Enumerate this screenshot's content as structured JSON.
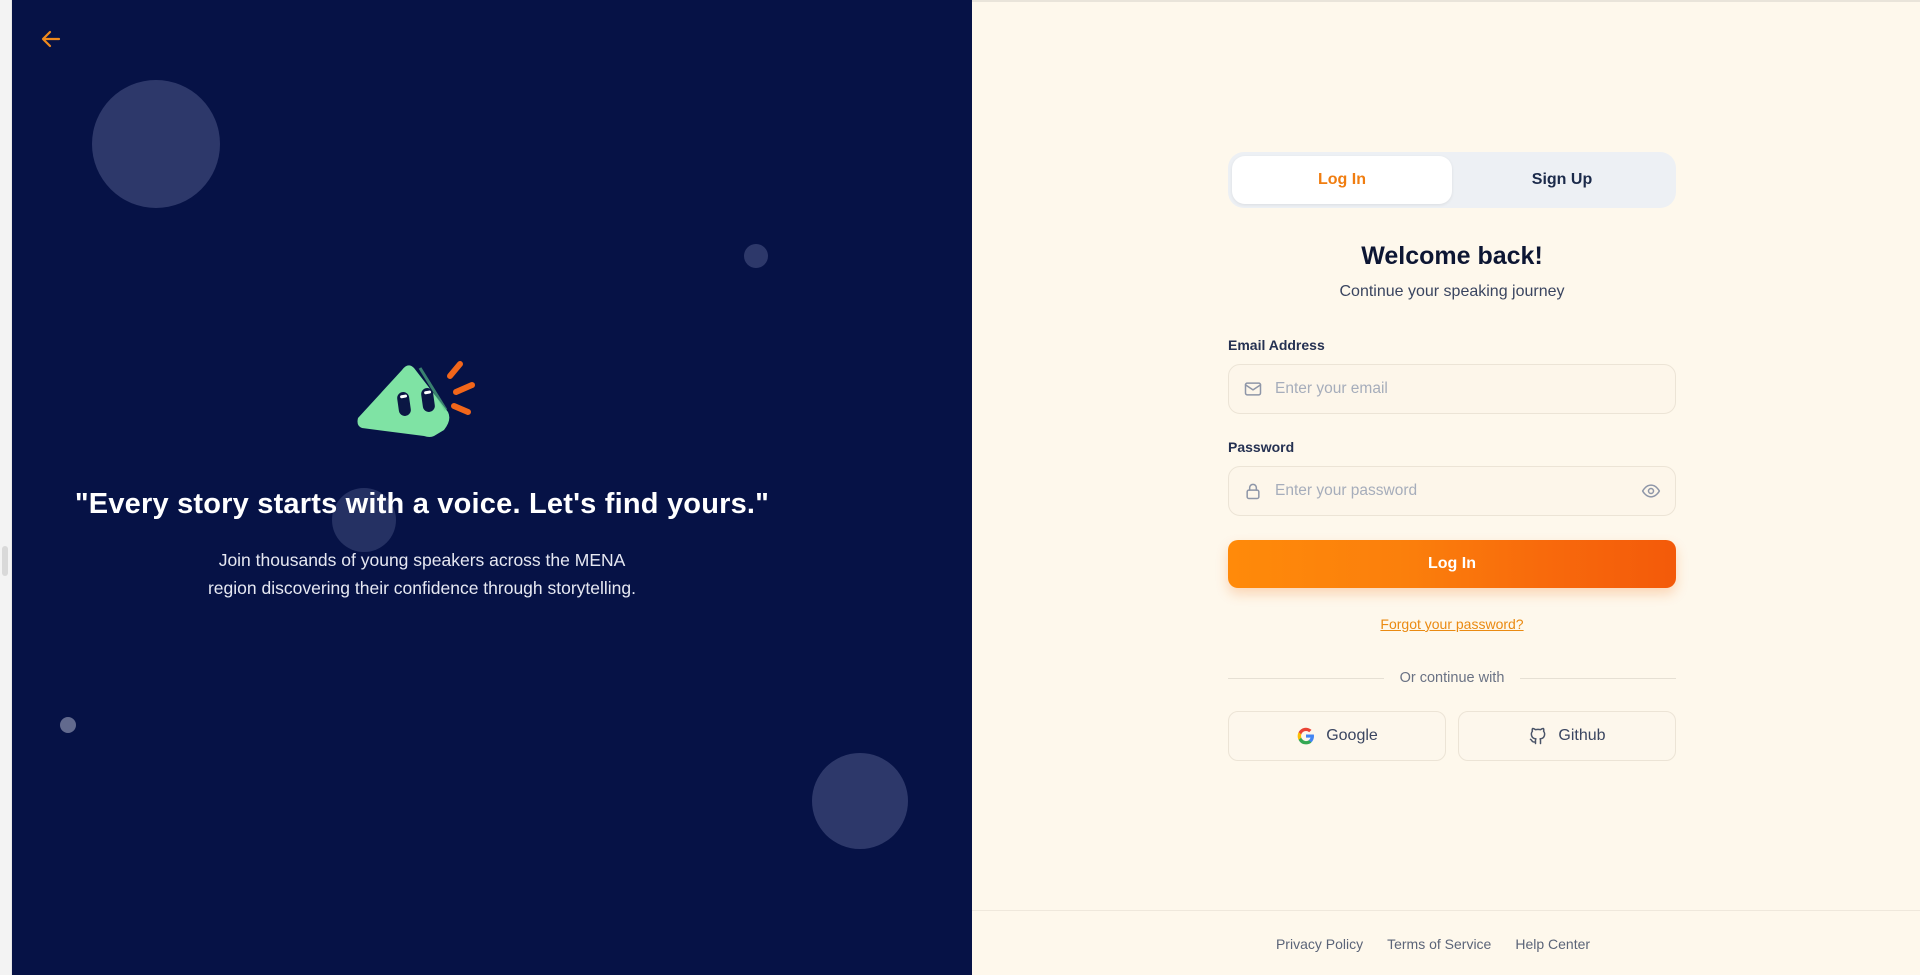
{
  "hero": {
    "back_icon": "arrow-left-icon",
    "mascot_icon": "megaphone-mascot-icon",
    "quote": "\"Every story starts with a voice. Let's find yours.\"",
    "subtitle": "Join thousands of young speakers across the MENA region discovering their confidence through storytelling."
  },
  "auth": {
    "tabs": [
      {
        "label": "Log In",
        "active": true
      },
      {
        "label": "Sign Up",
        "active": false
      }
    ],
    "title": "Welcome back!",
    "subtitle": "Continue your speaking journey",
    "email": {
      "label": "Email Address",
      "placeholder": "Enter your email",
      "icon": "mail-icon"
    },
    "password": {
      "label": "Password",
      "placeholder": "Enter your password",
      "icon": "lock-icon",
      "toggle_icon": "eye-icon"
    },
    "submit_label": "Log In",
    "forgot_label": "Forgot your password?",
    "divider_label": "Or continue with",
    "social": [
      {
        "label": "Google",
        "icon": "google-icon"
      },
      {
        "label": "Github",
        "icon": "github-icon"
      }
    ]
  },
  "footer": {
    "links": [
      "Privacy Policy",
      "Terms of Service",
      "Help Center"
    ]
  },
  "colors": {
    "hero_bg": "#061246",
    "accent": "#f07d10",
    "page_bg": "#fef8ec",
    "mascot_green": "#7fe3a4"
  }
}
